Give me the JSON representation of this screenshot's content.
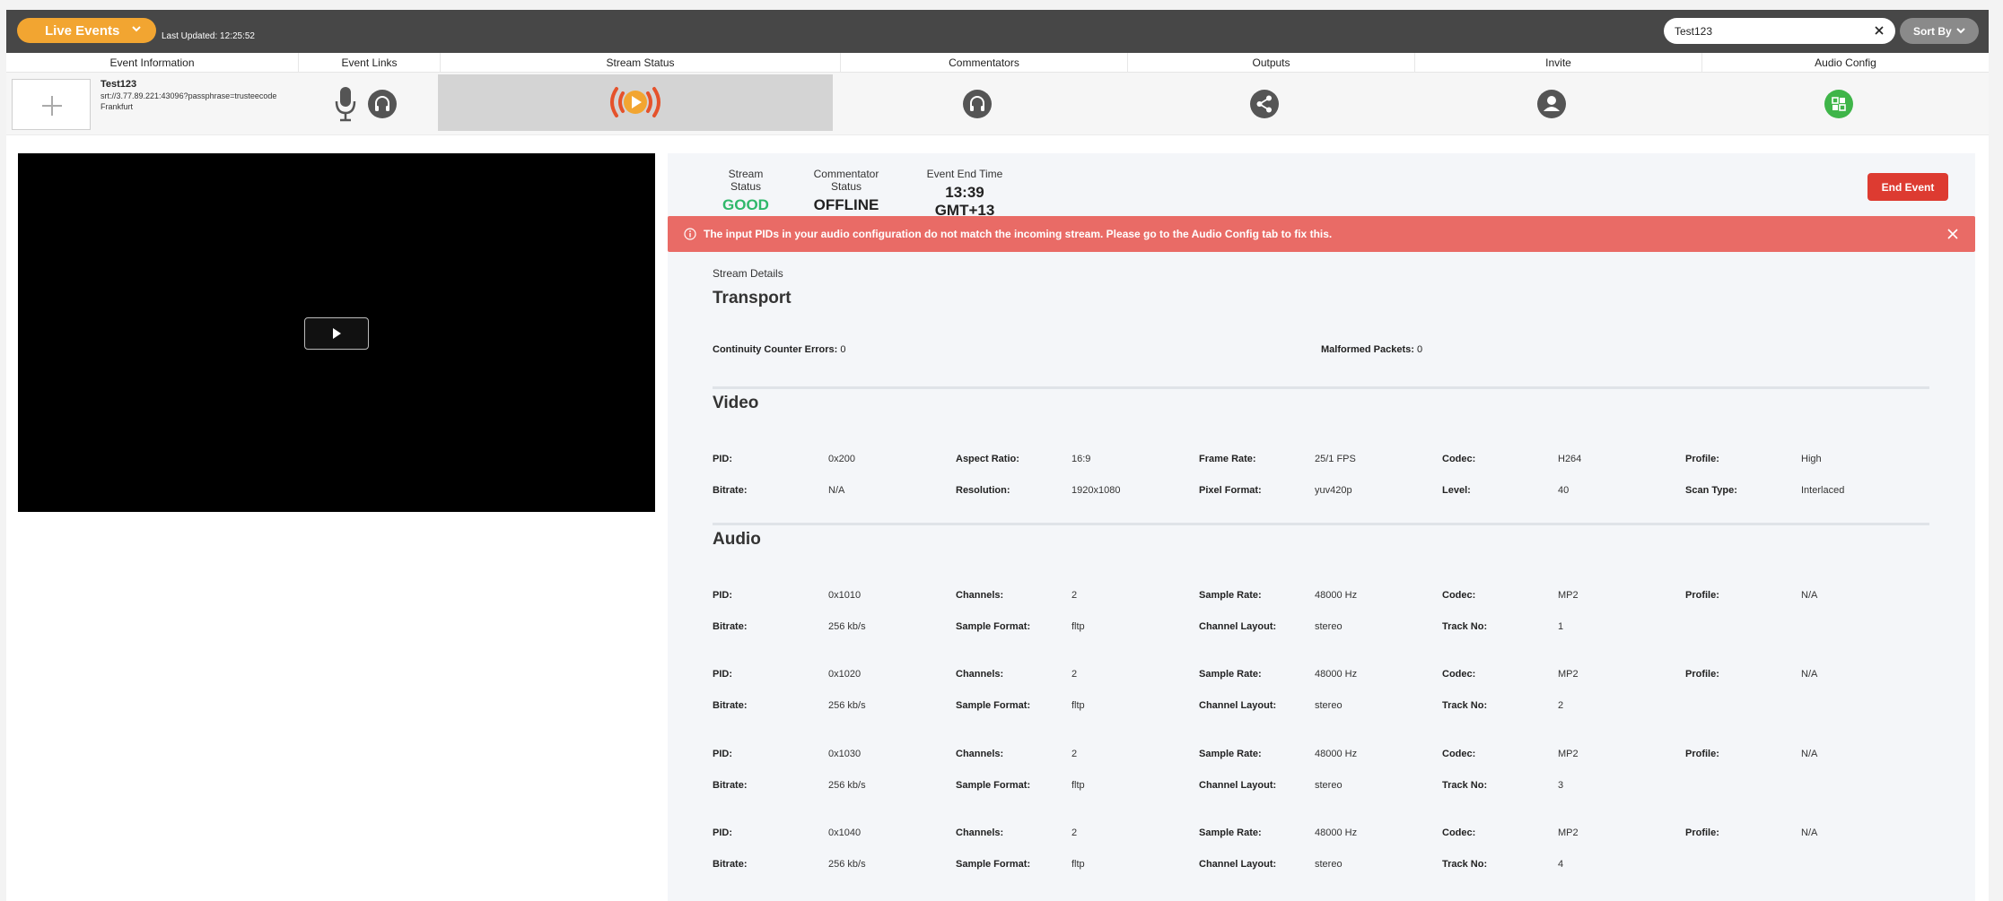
{
  "topbar": {
    "live_events_label": "Live Events",
    "last_updated": "Last Updated: 12:25:52",
    "search_value": "Test123",
    "sort_label": "Sort By"
  },
  "columns": [
    "Event Information",
    "Event Links",
    "Stream Status",
    "Commentators",
    "Outputs",
    "Invite",
    "Audio Config"
  ],
  "event": {
    "name": "Test123",
    "url": "srt://3.77.89.221:43096?passphrase=trusteecode",
    "location": "Frankfurt"
  },
  "colors": {
    "accent": "#f2a531",
    "good": "#2fb86a",
    "alert": "#e96b66",
    "danger": "#dd3b31",
    "audio_config": "#3fb549"
  },
  "status": {
    "stream_status_label": "Stream Status",
    "stream_status_value": "GOOD",
    "commentator_status_label": "Commentator Status",
    "commentator_status_value": "OFFLINE",
    "end_time_label": "Event End Time",
    "end_time_value": "13:39 GMT+13",
    "end_event_label": "End Event"
  },
  "alert": {
    "message": "The input PIDs in your audio configuration do not match the incoming stream. Please go to the Audio Config tab to fix this."
  },
  "details": {
    "label": "Stream Details",
    "transport": {
      "title": "Transport",
      "cc_errors_label": "Continuity Counter Errors:",
      "cc_errors_value": "0",
      "malformed_label": "Malformed Packets:",
      "malformed_value": "0"
    },
    "video": {
      "title": "Video",
      "rows": [
        [
          [
            "PID:",
            "0x200"
          ],
          [
            "Aspect Ratio:",
            "16:9"
          ],
          [
            "Frame Rate:",
            "25/1 FPS"
          ],
          [
            "Codec:",
            "H264"
          ],
          [
            "Profile:",
            "High"
          ]
        ],
        [
          [
            "Bitrate:",
            "N/A"
          ],
          [
            "Resolution:",
            "1920x1080"
          ],
          [
            "Pixel Format:",
            "yuv420p"
          ],
          [
            "Level:",
            "40"
          ],
          [
            "Scan Type:",
            "Interlaced"
          ]
        ]
      ]
    },
    "audio": {
      "title": "Audio",
      "tracks": [
        [
          [
            [
              "PID:",
              "0x1010"
            ],
            [
              "Channels:",
              "2"
            ],
            [
              "Sample Rate:",
              "48000 Hz"
            ],
            [
              "Codec:",
              "MP2"
            ],
            [
              "Profile:",
              "N/A"
            ]
          ],
          [
            [
              "Bitrate:",
              "256 kb/s"
            ],
            [
              "Sample Format:",
              "fltp"
            ],
            [
              "Channel Layout:",
              "stereo"
            ],
            [
              "Track No:",
              "1"
            ]
          ]
        ],
        [
          [
            [
              "PID:",
              "0x1020"
            ],
            [
              "Channels:",
              "2"
            ],
            [
              "Sample Rate:",
              "48000 Hz"
            ],
            [
              "Codec:",
              "MP2"
            ],
            [
              "Profile:",
              "N/A"
            ]
          ],
          [
            [
              "Bitrate:",
              "256 kb/s"
            ],
            [
              "Sample Format:",
              "fltp"
            ],
            [
              "Channel Layout:",
              "stereo"
            ],
            [
              "Track No:",
              "2"
            ]
          ]
        ],
        [
          [
            [
              "PID:",
              "0x1030"
            ],
            [
              "Channels:",
              "2"
            ],
            [
              "Sample Rate:",
              "48000 Hz"
            ],
            [
              "Codec:",
              "MP2"
            ],
            [
              "Profile:",
              "N/A"
            ]
          ],
          [
            [
              "Bitrate:",
              "256 kb/s"
            ],
            [
              "Sample Format:",
              "fltp"
            ],
            [
              "Channel Layout:",
              "stereo"
            ],
            [
              "Track No:",
              "3"
            ]
          ]
        ],
        [
          [
            [
              "PID:",
              "0x1040"
            ],
            [
              "Channels:",
              "2"
            ],
            [
              "Sample Rate:",
              "48000 Hz"
            ],
            [
              "Codec:",
              "MP2"
            ],
            [
              "Profile:",
              "N/A"
            ]
          ],
          [
            [
              "Bitrate:",
              "256 kb/s"
            ],
            [
              "Sample Format:",
              "fltp"
            ],
            [
              "Channel Layout:",
              "stereo"
            ],
            [
              "Track No:",
              "4"
            ]
          ]
        ]
      ]
    }
  }
}
